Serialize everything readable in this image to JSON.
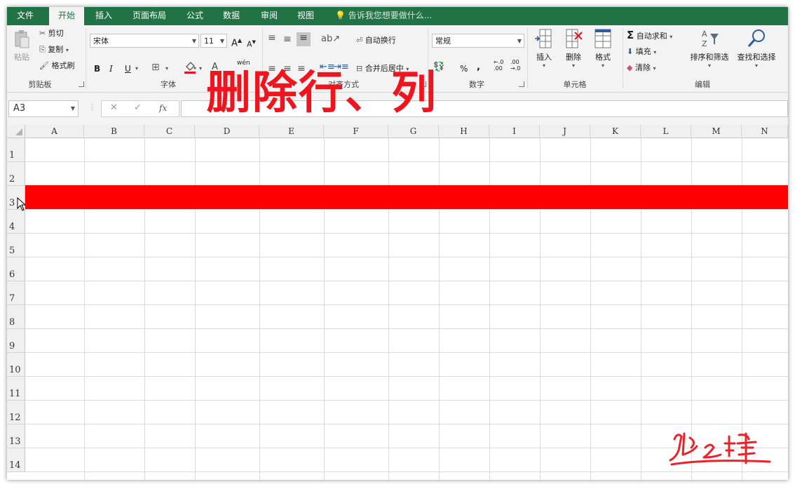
{
  "menu": {
    "tabs": [
      "文件",
      "开始",
      "插入",
      "页面布局",
      "公式",
      "数据",
      "审阅",
      "视图"
    ],
    "active": "开始",
    "tell_me": "告诉我您想要做什么..."
  },
  "ribbon": {
    "clipboard": {
      "paste": "粘贴",
      "cut": "剪切",
      "copy": "复制",
      "format_painter": "格式刷",
      "label": "剪贴板"
    },
    "font": {
      "name": "宋体",
      "size": "11",
      "bold": "B",
      "italic": "I",
      "underline": "U",
      "grow": "A",
      "shrink": "A",
      "phonetic": "wén",
      "label": "字体"
    },
    "alignment": {
      "wrap_text": "自动换行",
      "merge_center": "合并后居中",
      "label": "对齐方式"
    },
    "number": {
      "format": "常规",
      "percent": "%",
      "comma": ",",
      "inc_decimal_top": "←.0",
      "inc_decimal_bottom": ".00",
      "dec_decimal_top": ".00",
      "dec_decimal_bottom": "→.0",
      "label": "数字"
    },
    "cells": {
      "insert": "插入",
      "delete": "删除",
      "format": "格式",
      "label": "单元格"
    },
    "editing": {
      "autosum": "自动求和",
      "fill": "填充",
      "clear": "清除",
      "sort_filter": "排序和筛选",
      "find_select": "查找和选择",
      "label": "编辑"
    }
  },
  "formula_bar": {
    "name_box": "A3",
    "cancel": "✕",
    "enter": "✓",
    "fx": "fx",
    "value": ""
  },
  "overlay_title": "删除行、列",
  "sheet": {
    "columns": [
      "A",
      "B",
      "C",
      "D",
      "E",
      "F",
      "G",
      "H",
      "I",
      "J",
      "K",
      "L",
      "M",
      "N"
    ],
    "rows": [
      "1",
      "2",
      "3",
      "4",
      "5",
      "6",
      "7",
      "8",
      "9",
      "10",
      "11",
      "12",
      "13",
      "14"
    ],
    "selected_row": "3"
  },
  "colors": {
    "brand": "#217346",
    "highlight_row": "#ff0000",
    "overlay_text": "#f0141e"
  }
}
